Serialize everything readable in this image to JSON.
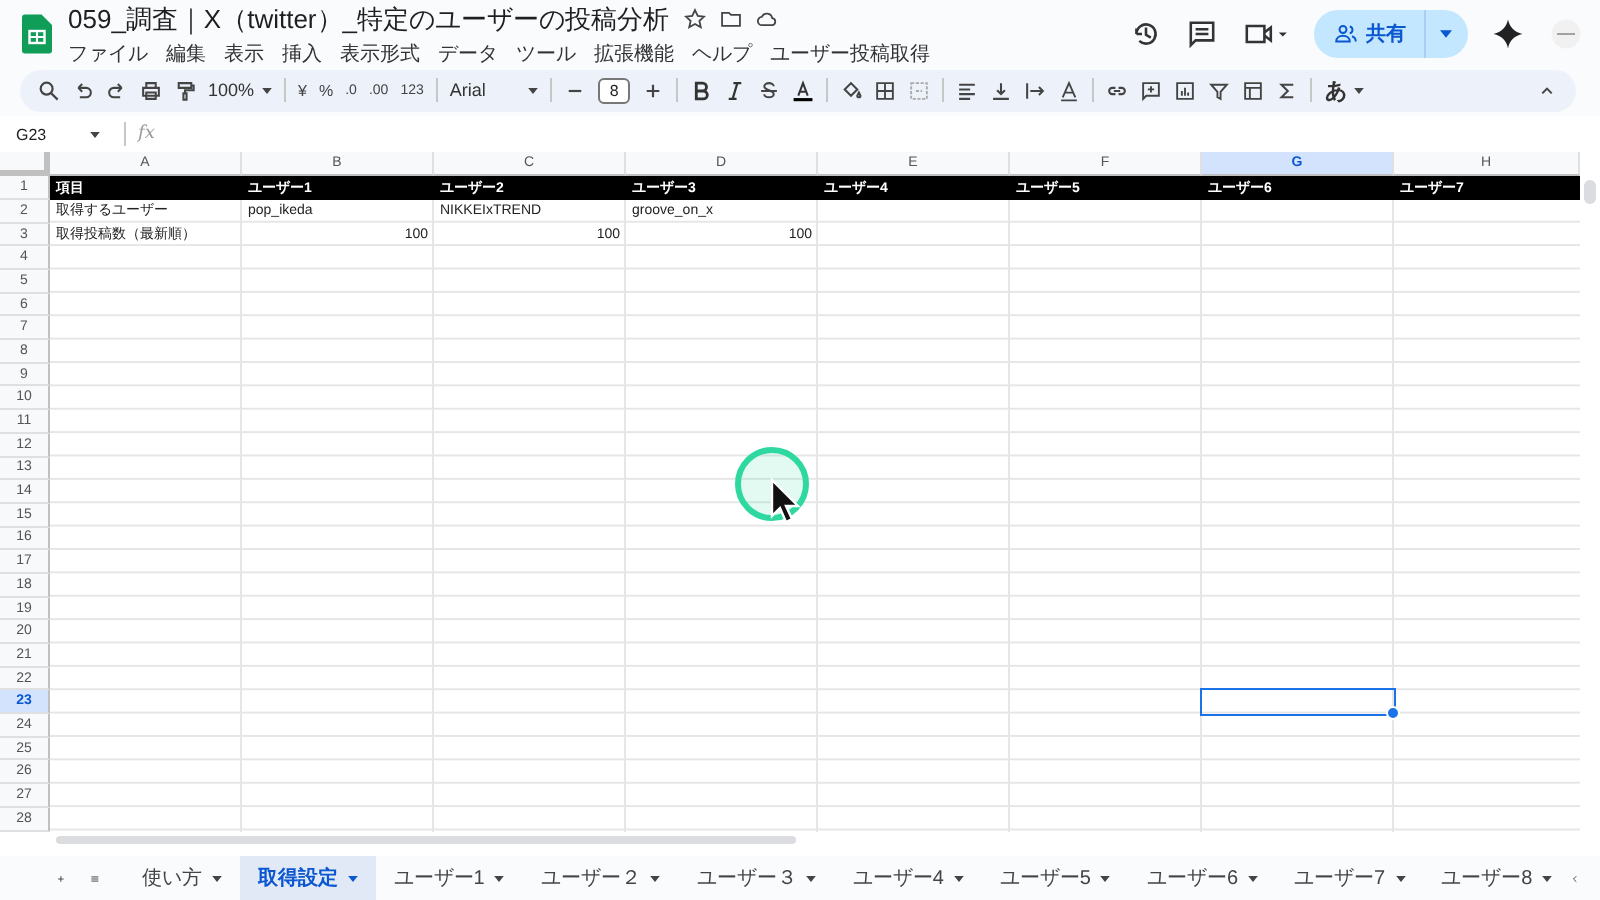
{
  "document": {
    "title": "059_調査｜X（twitter）_特定のユーザーの投稿分析",
    "menus": [
      "ファイル",
      "編集",
      "表示",
      "挿入",
      "表示形式",
      "データ",
      "ツール",
      "拡張機能",
      "ヘルプ",
      "ユーザー投稿取得"
    ],
    "share_label": "共有"
  },
  "toolbar": {
    "zoom": "100%",
    "currency": "¥",
    "percent": "%",
    "decrease_decimal": ".0",
    "increase_decimal": ".00",
    "number_format": "123",
    "font": "Arial",
    "font_size": "8",
    "input_tools": "あ"
  },
  "formula_bar": {
    "name_box": "G23",
    "fx": "fx"
  },
  "columns": [
    {
      "label": "A",
      "selected": false
    },
    {
      "label": "B",
      "selected": false
    },
    {
      "label": "C",
      "selected": false
    },
    {
      "label": "D",
      "selected": false
    },
    {
      "label": "E",
      "selected": false
    },
    {
      "label": "F",
      "selected": false
    },
    {
      "label": "G",
      "selected": true
    },
    {
      "label": "H",
      "selected": false
    }
  ],
  "row_numbers": [
    {
      "label": "1",
      "selected": false
    },
    {
      "label": "2",
      "selected": false
    },
    {
      "label": "3",
      "selected": false
    },
    {
      "label": "4",
      "selected": false
    },
    {
      "label": "5",
      "selected": false
    },
    {
      "label": "6",
      "selected": false
    },
    {
      "label": "7",
      "selected": false
    },
    {
      "label": "8",
      "selected": false
    },
    {
      "label": "9",
      "selected": false
    },
    {
      "label": "10",
      "selected": false
    },
    {
      "label": "11",
      "selected": false
    },
    {
      "label": "12",
      "selected": false
    },
    {
      "label": "13",
      "selected": false
    },
    {
      "label": "14",
      "selected": false
    },
    {
      "label": "15",
      "selected": false
    },
    {
      "label": "16",
      "selected": false
    },
    {
      "label": "17",
      "selected": false
    },
    {
      "label": "18",
      "selected": false
    },
    {
      "label": "19",
      "selected": false
    },
    {
      "label": "20",
      "selected": false
    },
    {
      "label": "21",
      "selected": false
    },
    {
      "label": "22",
      "selected": false
    },
    {
      "label": "23",
      "selected": true
    },
    {
      "label": "24",
      "selected": false
    },
    {
      "label": "25",
      "selected": false
    },
    {
      "label": "26",
      "selected": false
    },
    {
      "label": "27",
      "selected": false
    },
    {
      "label": "28",
      "selected": false
    }
  ],
  "rows": [
    {
      "kind": "header",
      "cells": [
        {
          "text": "項目",
          "kind": "text"
        },
        {
          "text": "ユーザー1",
          "kind": "text"
        },
        {
          "text": "ユーザー2",
          "kind": "text"
        },
        {
          "text": "ユーザー3",
          "kind": "text"
        },
        {
          "text": "ユーザー4",
          "kind": "text"
        },
        {
          "text": "ユーザー5",
          "kind": "text"
        },
        {
          "text": "ユーザー6",
          "kind": "text"
        },
        {
          "text": "ユーザー7",
          "kind": "text"
        }
      ]
    },
    {
      "kind": "body",
      "cells": [
        {
          "text": "取得するユーザー",
          "kind": "text"
        },
        {
          "text": "pop_ikeda",
          "kind": "text"
        },
        {
          "text": "NIKKEIxTREND",
          "kind": "text"
        },
        {
          "text": "groove_on_x",
          "kind": "text"
        }
      ]
    },
    {
      "kind": "body",
      "cells": [
        {
          "text": "取得投稿数（最新順）",
          "kind": "text"
        },
        {
          "text": "100",
          "kind": "number"
        },
        {
          "text": "100",
          "kind": "number"
        },
        {
          "text": "100",
          "kind": "number"
        }
      ]
    }
  ],
  "sheet_tabs": [
    {
      "label": "使い方",
      "selected": false
    },
    {
      "label": "取得設定",
      "selected": true
    },
    {
      "label": "ユーザー1",
      "selected": false
    },
    {
      "label": "ユーザー２",
      "selected": false
    },
    {
      "label": "ユーザー３",
      "selected": false
    },
    {
      "label": "ユーザー4",
      "selected": false
    },
    {
      "label": "ユーザー5",
      "selected": false
    },
    {
      "label": "ユーザー6",
      "selected": false
    },
    {
      "label": "ユーザー7",
      "selected": false
    },
    {
      "label": "ユーザー8",
      "selected": false
    }
  ]
}
